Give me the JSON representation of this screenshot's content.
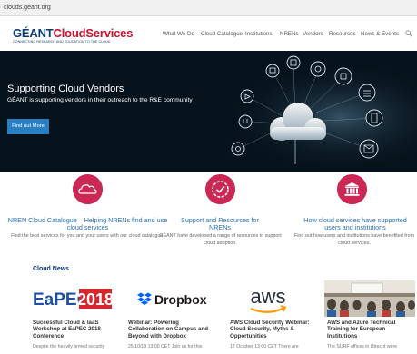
{
  "browser": {
    "url": "clouds.geant.org"
  },
  "header": {
    "logo_geant": "GÉANT",
    "logo_cloud": "CloudServices",
    "logo_tagline": "CONNECTING RESEARCH AND EDUCATION TO THE CLOUD",
    "nav": [
      "What We Do",
      "Cloud Catalogue",
      "Institutions",
      "NRENs",
      "Vendors",
      "Resources",
      "News & Events"
    ],
    "search_icon": "search-icon"
  },
  "hero": {
    "title": "Supporting Cloud Vendors",
    "subtitle": "GÉANT is supporting vendors in their outreach to the R&E community",
    "button": "Find out More"
  },
  "features": [
    {
      "icon": "cloud-icon",
      "title": "NREN Cloud Catalogue – Helping NRENs find and use cloud services",
      "desc": "Find the best services for you and your users with our cloud catalogue."
    },
    {
      "icon": "settings-badge-icon",
      "title": "Support and Resources for NRENs",
      "desc": "GÉANT have developed a range of resources to support cloud adoption."
    },
    {
      "icon": "institution-icon",
      "title": "How cloud services have supported users and institutions",
      "desc": "Find out how users and institutions have benefited from cloud services."
    }
  ],
  "news": {
    "heading": "Cloud News",
    "cards": [
      {
        "image_text": "EaPEC",
        "image_year": "2018",
        "title": "Successful Cloud & IaaS Workshop at EaPEC 2018 Conference",
        "text": "Despite the heavily armed security"
      },
      {
        "image_text": "Dropbox",
        "title": "Webinar: Powering Collaboration on Campus and Beyond with Dropbox",
        "text": "25/10/18 13:00 CET Join us for this"
      },
      {
        "image_text": "aws",
        "title": "AWS Cloud Security Webinar: Cloud Security, Myths & Opportunities",
        "text": "17 October 13:00 CET There are"
      },
      {
        "title": "AWS and Azure Technical Training for European Institutions",
        "text": "The SURF offices in Utrecht were"
      }
    ]
  },
  "colors": {
    "brand_navy": "#0b3b6f",
    "brand_red": "#c8102e",
    "feature_pink": "#cc2856",
    "link_blue": "#2870b4",
    "button_blue": "#2a7ec2",
    "dropbox_blue": "#0061fe",
    "aws_orange": "#ff9900"
  }
}
